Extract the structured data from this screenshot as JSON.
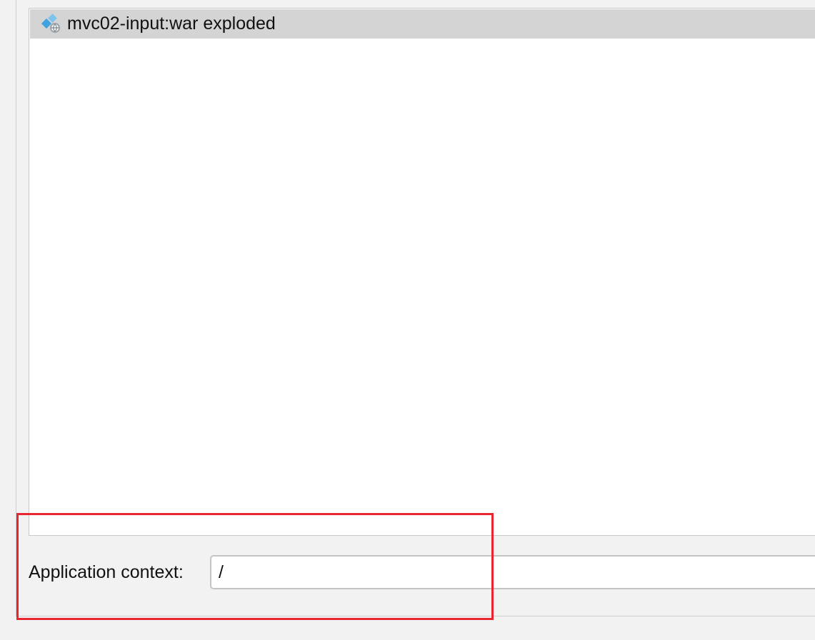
{
  "artifacts": {
    "items": [
      {
        "label": "mvc02-input:war exploded",
        "icon": "web-artifact-icon"
      }
    ]
  },
  "context": {
    "label": "Application context:",
    "value": "/"
  },
  "colors": {
    "highlight": "#e8262f",
    "selection": "#d4d4d4"
  }
}
